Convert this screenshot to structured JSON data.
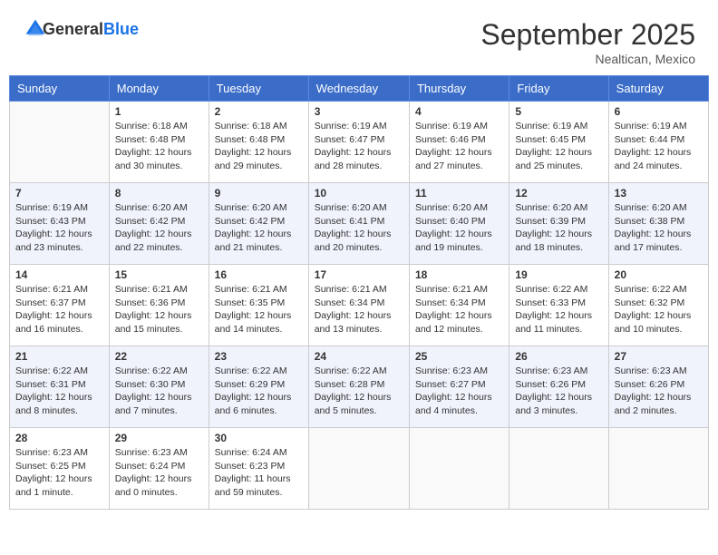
{
  "header": {
    "logo_general": "General",
    "logo_blue": "Blue",
    "month_title": "September 2025",
    "location": "Nealtican, Mexico"
  },
  "days_of_week": [
    "Sunday",
    "Monday",
    "Tuesday",
    "Wednesday",
    "Thursday",
    "Friday",
    "Saturday"
  ],
  "weeks": [
    [
      {
        "day": "",
        "info": ""
      },
      {
        "day": "1",
        "info": "Sunrise: 6:18 AM\nSunset: 6:48 PM\nDaylight: 12 hours\nand 30 minutes."
      },
      {
        "day": "2",
        "info": "Sunrise: 6:18 AM\nSunset: 6:48 PM\nDaylight: 12 hours\nand 29 minutes."
      },
      {
        "day": "3",
        "info": "Sunrise: 6:19 AM\nSunset: 6:47 PM\nDaylight: 12 hours\nand 28 minutes."
      },
      {
        "day": "4",
        "info": "Sunrise: 6:19 AM\nSunset: 6:46 PM\nDaylight: 12 hours\nand 27 minutes."
      },
      {
        "day": "5",
        "info": "Sunrise: 6:19 AM\nSunset: 6:45 PM\nDaylight: 12 hours\nand 25 minutes."
      },
      {
        "day": "6",
        "info": "Sunrise: 6:19 AM\nSunset: 6:44 PM\nDaylight: 12 hours\nand 24 minutes."
      }
    ],
    [
      {
        "day": "7",
        "info": "Sunrise: 6:19 AM\nSunset: 6:43 PM\nDaylight: 12 hours\nand 23 minutes."
      },
      {
        "day": "8",
        "info": "Sunrise: 6:20 AM\nSunset: 6:42 PM\nDaylight: 12 hours\nand 22 minutes."
      },
      {
        "day": "9",
        "info": "Sunrise: 6:20 AM\nSunset: 6:42 PM\nDaylight: 12 hours\nand 21 minutes."
      },
      {
        "day": "10",
        "info": "Sunrise: 6:20 AM\nSunset: 6:41 PM\nDaylight: 12 hours\nand 20 minutes."
      },
      {
        "day": "11",
        "info": "Sunrise: 6:20 AM\nSunset: 6:40 PM\nDaylight: 12 hours\nand 19 minutes."
      },
      {
        "day": "12",
        "info": "Sunrise: 6:20 AM\nSunset: 6:39 PM\nDaylight: 12 hours\nand 18 minutes."
      },
      {
        "day": "13",
        "info": "Sunrise: 6:20 AM\nSunset: 6:38 PM\nDaylight: 12 hours\nand 17 minutes."
      }
    ],
    [
      {
        "day": "14",
        "info": "Sunrise: 6:21 AM\nSunset: 6:37 PM\nDaylight: 12 hours\nand 16 minutes."
      },
      {
        "day": "15",
        "info": "Sunrise: 6:21 AM\nSunset: 6:36 PM\nDaylight: 12 hours\nand 15 minutes."
      },
      {
        "day": "16",
        "info": "Sunrise: 6:21 AM\nSunset: 6:35 PM\nDaylight: 12 hours\nand 14 minutes."
      },
      {
        "day": "17",
        "info": "Sunrise: 6:21 AM\nSunset: 6:34 PM\nDaylight: 12 hours\nand 13 minutes."
      },
      {
        "day": "18",
        "info": "Sunrise: 6:21 AM\nSunset: 6:34 PM\nDaylight: 12 hours\nand 12 minutes."
      },
      {
        "day": "19",
        "info": "Sunrise: 6:22 AM\nSunset: 6:33 PM\nDaylight: 12 hours\nand 11 minutes."
      },
      {
        "day": "20",
        "info": "Sunrise: 6:22 AM\nSunset: 6:32 PM\nDaylight: 12 hours\nand 10 minutes."
      }
    ],
    [
      {
        "day": "21",
        "info": "Sunrise: 6:22 AM\nSunset: 6:31 PM\nDaylight: 12 hours\nand 8 minutes."
      },
      {
        "day": "22",
        "info": "Sunrise: 6:22 AM\nSunset: 6:30 PM\nDaylight: 12 hours\nand 7 minutes."
      },
      {
        "day": "23",
        "info": "Sunrise: 6:22 AM\nSunset: 6:29 PM\nDaylight: 12 hours\nand 6 minutes."
      },
      {
        "day": "24",
        "info": "Sunrise: 6:22 AM\nSunset: 6:28 PM\nDaylight: 12 hours\nand 5 minutes."
      },
      {
        "day": "25",
        "info": "Sunrise: 6:23 AM\nSunset: 6:27 PM\nDaylight: 12 hours\nand 4 minutes."
      },
      {
        "day": "26",
        "info": "Sunrise: 6:23 AM\nSunset: 6:26 PM\nDaylight: 12 hours\nand 3 minutes."
      },
      {
        "day": "27",
        "info": "Sunrise: 6:23 AM\nSunset: 6:26 PM\nDaylight: 12 hours\nand 2 minutes."
      }
    ],
    [
      {
        "day": "28",
        "info": "Sunrise: 6:23 AM\nSunset: 6:25 PM\nDaylight: 12 hours\nand 1 minute."
      },
      {
        "day": "29",
        "info": "Sunrise: 6:23 AM\nSunset: 6:24 PM\nDaylight: 12 hours\nand 0 minutes."
      },
      {
        "day": "30",
        "info": "Sunrise: 6:24 AM\nSunset: 6:23 PM\nDaylight: 11 hours\nand 59 minutes."
      },
      {
        "day": "",
        "info": ""
      },
      {
        "day": "",
        "info": ""
      },
      {
        "day": "",
        "info": ""
      },
      {
        "day": "",
        "info": ""
      }
    ]
  ]
}
